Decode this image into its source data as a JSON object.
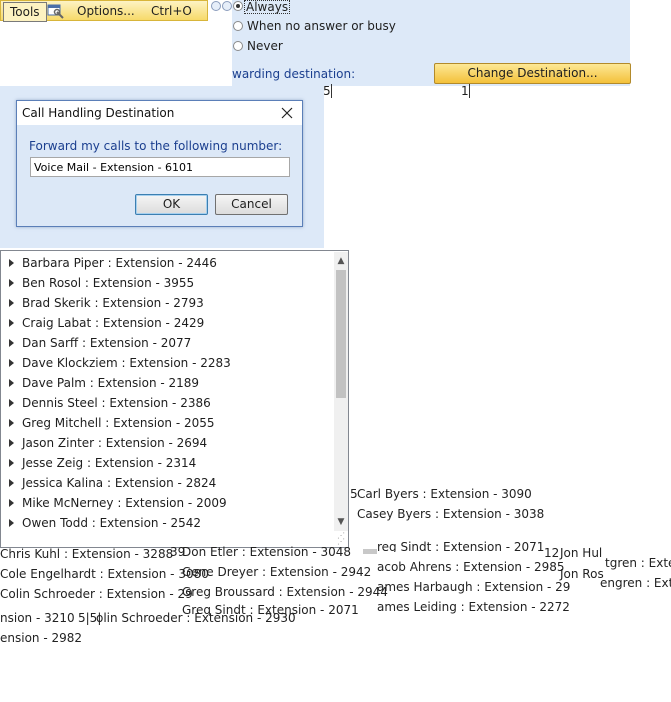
{
  "menubar": {
    "tools_label": "Tools",
    "options_label": "Options...",
    "options_shortcut": "Ctrl+O",
    "options_icon": "options-icon"
  },
  "forwarding_options": {
    "always_label": "Always",
    "no_answer_label": "When no answer or busy",
    "never_label": "Never",
    "selected": "Always",
    "destination_label": "warding destination:",
    "change_button_label": "Change Destination...",
    "value_a": "5",
    "value_b": "1"
  },
  "dialog": {
    "title": "Call Handling Destination",
    "prompt": "Forward my calls to the following number:",
    "input_value": "Voice Mail - Extension - 6101",
    "ok_label": "OK",
    "cancel_label": "Cancel"
  },
  "contact_list": [
    "Barbara Piper : Extension - 2446",
    "Ben Rosol : Extension - 3955",
    "Brad Skerik : Extension - 2793",
    "Craig Labat : Extension - 2429",
    "Dan Sarff : Extension - 2077",
    "Dave Klockziem : Extension - 2283",
    "Dave Palm : Extension - 2189",
    "Dennis Steel : Extension - 2386",
    "Greg Mitchell : Extension - 2055",
    "Jason Zinter : Extension - 2694",
    "Jesse Zeig : Extension - 2314",
    "Jessica Kalina : Extension - 2824",
    "Mike McNerney : Extension - 2009",
    "Owen Todd : Extension - 2542"
  ],
  "background": {
    "col_right_top": [
      "Carl Byers : Extension - 3090",
      "Casey Byers : Extension - 3038"
    ],
    "col1": [
      "Chris Kuhl : Extension - 3288",
      "Cole Engelhardt : Extension - 3080",
      "Colin Schroeder : Extension - 29",
      "nsion - 3210",
      "ension - 2982"
    ],
    "col2": [
      "Don Etler : Extension - 3048",
      "Gene Dreyer : Extension - 2942",
      "Greg Broussard : Extension - 2944",
      "Greg Sindt : Extension - 2071",
      "olin Schroeder : Extension - 2930"
    ],
    "col3": [
      "reg Sindt : Extension - 2071",
      "acob Ahrens : Extension - 2985",
      "ames Harbaugh : Extension - 29",
      "ames Leiding : Extension - 2272"
    ],
    "col4": [
      "Jon Hul",
      "Jon Ros",
      "tgren : Exten",
      "engren : Exte"
    ],
    "fragments": [
      "5",
      "39",
      "12",
      "5",
      "5|5|"
    ]
  }
}
